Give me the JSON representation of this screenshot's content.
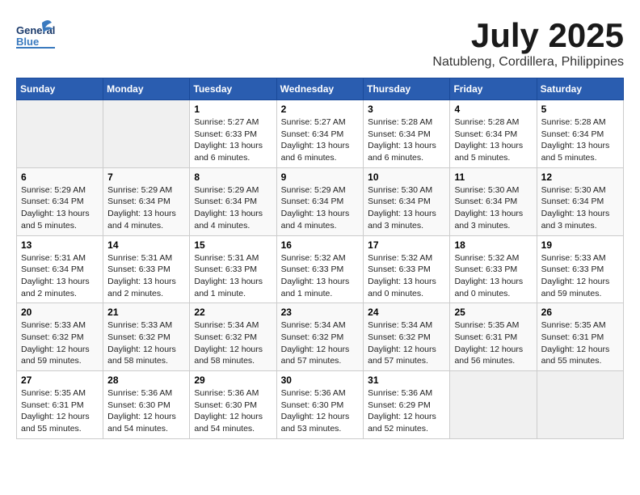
{
  "header": {
    "logo_general": "General",
    "logo_blue": "Blue",
    "month": "July 2025",
    "location": "Natubleng, Cordillera, Philippines"
  },
  "weekdays": [
    "Sunday",
    "Monday",
    "Tuesday",
    "Wednesday",
    "Thursday",
    "Friday",
    "Saturday"
  ],
  "weeks": [
    [
      {
        "day": "",
        "info": ""
      },
      {
        "day": "",
        "info": ""
      },
      {
        "day": "1",
        "info": "Sunrise: 5:27 AM\nSunset: 6:33 PM\nDaylight: 13 hours and 6 minutes."
      },
      {
        "day": "2",
        "info": "Sunrise: 5:27 AM\nSunset: 6:34 PM\nDaylight: 13 hours and 6 minutes."
      },
      {
        "day": "3",
        "info": "Sunrise: 5:28 AM\nSunset: 6:34 PM\nDaylight: 13 hours and 6 minutes."
      },
      {
        "day": "4",
        "info": "Sunrise: 5:28 AM\nSunset: 6:34 PM\nDaylight: 13 hours and 5 minutes."
      },
      {
        "day": "5",
        "info": "Sunrise: 5:28 AM\nSunset: 6:34 PM\nDaylight: 13 hours and 5 minutes."
      }
    ],
    [
      {
        "day": "6",
        "info": "Sunrise: 5:29 AM\nSunset: 6:34 PM\nDaylight: 13 hours and 5 minutes."
      },
      {
        "day": "7",
        "info": "Sunrise: 5:29 AM\nSunset: 6:34 PM\nDaylight: 13 hours and 4 minutes."
      },
      {
        "day": "8",
        "info": "Sunrise: 5:29 AM\nSunset: 6:34 PM\nDaylight: 13 hours and 4 minutes."
      },
      {
        "day": "9",
        "info": "Sunrise: 5:29 AM\nSunset: 6:34 PM\nDaylight: 13 hours and 4 minutes."
      },
      {
        "day": "10",
        "info": "Sunrise: 5:30 AM\nSunset: 6:34 PM\nDaylight: 13 hours and 3 minutes."
      },
      {
        "day": "11",
        "info": "Sunrise: 5:30 AM\nSunset: 6:34 PM\nDaylight: 13 hours and 3 minutes."
      },
      {
        "day": "12",
        "info": "Sunrise: 5:30 AM\nSunset: 6:34 PM\nDaylight: 13 hours and 3 minutes."
      }
    ],
    [
      {
        "day": "13",
        "info": "Sunrise: 5:31 AM\nSunset: 6:34 PM\nDaylight: 13 hours and 2 minutes."
      },
      {
        "day": "14",
        "info": "Sunrise: 5:31 AM\nSunset: 6:33 PM\nDaylight: 13 hours and 2 minutes."
      },
      {
        "day": "15",
        "info": "Sunrise: 5:31 AM\nSunset: 6:33 PM\nDaylight: 13 hours and 1 minute."
      },
      {
        "day": "16",
        "info": "Sunrise: 5:32 AM\nSunset: 6:33 PM\nDaylight: 13 hours and 1 minute."
      },
      {
        "day": "17",
        "info": "Sunrise: 5:32 AM\nSunset: 6:33 PM\nDaylight: 13 hours and 0 minutes."
      },
      {
        "day": "18",
        "info": "Sunrise: 5:32 AM\nSunset: 6:33 PM\nDaylight: 13 hours and 0 minutes."
      },
      {
        "day": "19",
        "info": "Sunrise: 5:33 AM\nSunset: 6:33 PM\nDaylight: 12 hours and 59 minutes."
      }
    ],
    [
      {
        "day": "20",
        "info": "Sunrise: 5:33 AM\nSunset: 6:32 PM\nDaylight: 12 hours and 59 minutes."
      },
      {
        "day": "21",
        "info": "Sunrise: 5:33 AM\nSunset: 6:32 PM\nDaylight: 12 hours and 58 minutes."
      },
      {
        "day": "22",
        "info": "Sunrise: 5:34 AM\nSunset: 6:32 PM\nDaylight: 12 hours and 58 minutes."
      },
      {
        "day": "23",
        "info": "Sunrise: 5:34 AM\nSunset: 6:32 PM\nDaylight: 12 hours and 57 minutes."
      },
      {
        "day": "24",
        "info": "Sunrise: 5:34 AM\nSunset: 6:32 PM\nDaylight: 12 hours and 57 minutes."
      },
      {
        "day": "25",
        "info": "Sunrise: 5:35 AM\nSunset: 6:31 PM\nDaylight: 12 hours and 56 minutes."
      },
      {
        "day": "26",
        "info": "Sunrise: 5:35 AM\nSunset: 6:31 PM\nDaylight: 12 hours and 55 minutes."
      }
    ],
    [
      {
        "day": "27",
        "info": "Sunrise: 5:35 AM\nSunset: 6:31 PM\nDaylight: 12 hours and 55 minutes."
      },
      {
        "day": "28",
        "info": "Sunrise: 5:36 AM\nSunset: 6:30 PM\nDaylight: 12 hours and 54 minutes."
      },
      {
        "day": "29",
        "info": "Sunrise: 5:36 AM\nSunset: 6:30 PM\nDaylight: 12 hours and 54 minutes."
      },
      {
        "day": "30",
        "info": "Sunrise: 5:36 AM\nSunset: 6:30 PM\nDaylight: 12 hours and 53 minutes."
      },
      {
        "day": "31",
        "info": "Sunrise: 5:36 AM\nSunset: 6:29 PM\nDaylight: 12 hours and 52 minutes."
      },
      {
        "day": "",
        "info": ""
      },
      {
        "day": "",
        "info": ""
      }
    ]
  ]
}
